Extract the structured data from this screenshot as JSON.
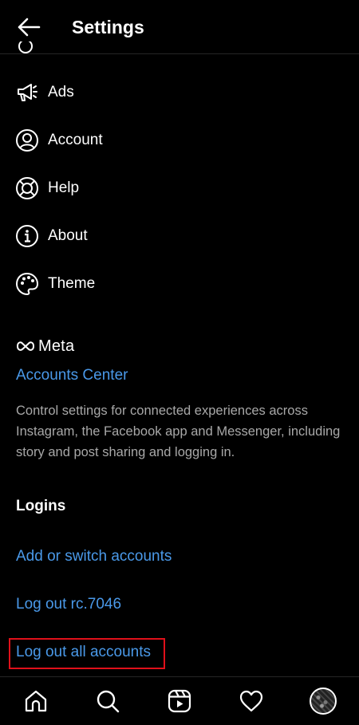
{
  "header": {
    "title": "Settings",
    "back_icon": "arrow-left-icon"
  },
  "menu": [
    {
      "label": "Ads",
      "icon": "megaphone-icon"
    },
    {
      "label": "Account",
      "icon": "user-circle-icon"
    },
    {
      "label": "Help",
      "icon": "lifebuoy-icon"
    },
    {
      "label": "About",
      "icon": "info-circle-icon"
    },
    {
      "label": "Theme",
      "icon": "palette-icon"
    }
  ],
  "meta": {
    "brand": "Meta",
    "accounts_center": "Accounts Center",
    "description": "Control settings for connected experiences across Instagram, the Facebook app and Messenger, including story and post sharing and logging in."
  },
  "logins": {
    "title": "Logins",
    "add_switch": "Add or switch accounts",
    "log_out_user": "Log out rc.7046",
    "log_out_all": "Log out all accounts"
  },
  "tabbar": {
    "items": [
      "home-icon",
      "search-icon",
      "reels-icon",
      "heart-icon",
      "profile-avatar"
    ]
  },
  "colors": {
    "background": "#000000",
    "link": "#4a99e9",
    "secondary_text": "#a8a8a8",
    "highlight": "#e0101a"
  }
}
